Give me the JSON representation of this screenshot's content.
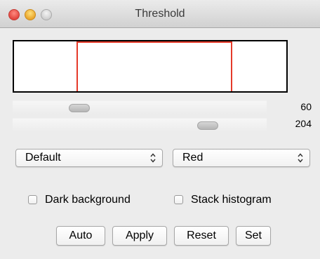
{
  "window": {
    "title": "Threshold"
  },
  "histogram": {
    "frame_color": "#000000",
    "threshold_color": "#e53a2a"
  },
  "sliders": {
    "lower": {
      "value": "60"
    },
    "upper": {
      "value": "204"
    }
  },
  "method_select": {
    "selected": "Default"
  },
  "display_select": {
    "selected": "Red"
  },
  "checkboxes": {
    "dark_background": {
      "label": "Dark background",
      "checked": false
    },
    "stack_histogram": {
      "label": "Stack histogram",
      "checked": false
    }
  },
  "buttons": {
    "auto": "Auto",
    "apply": "Apply",
    "reset": "Reset",
    "set": "Set"
  },
  "icons": {
    "close": "close-icon",
    "minimize": "minimize-icon",
    "zoom": "zoom-icon",
    "select_arrows": "up-down-arrows-icon"
  }
}
